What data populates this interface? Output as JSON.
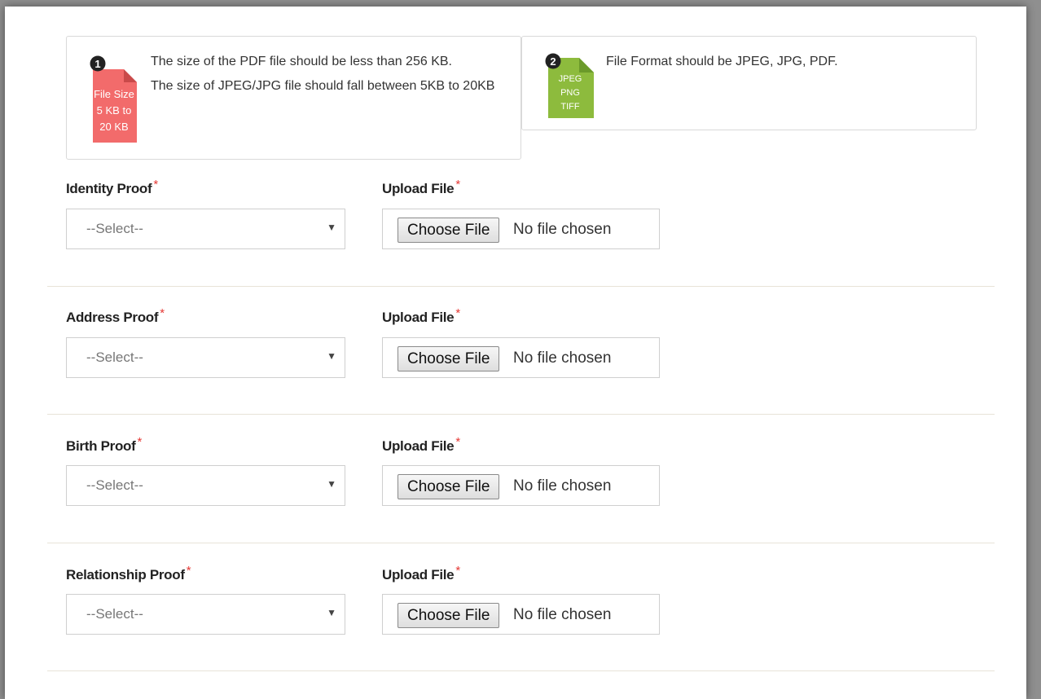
{
  "info_cards": [
    {
      "badge": "1",
      "icon_lines": [
        "File Size",
        "5 KB to",
        "20 KB"
      ],
      "icon_color": "#f26b6b",
      "text": [
        "The size of the PDF file should be less than 256 KB.",
        "The size of JPEG/JPG file should fall between 5KB to 20KB"
      ]
    },
    {
      "badge": "2",
      "icon_lines": [
        "JPEG",
        "PNG",
        "TIFF"
      ],
      "icon_color": "#8dbb3d",
      "text": [
        "File Format should be JPEG, JPG, PDF."
      ]
    }
  ],
  "required_marker": "*",
  "rows": [
    {
      "label": "Identity Proof",
      "select_value": "--Select--",
      "upload_label": "Upload File",
      "button": "Choose File",
      "file_status": "No file chosen"
    },
    {
      "label": "Address Proof",
      "select_value": "--Select--",
      "upload_label": "Upload File",
      "button": "Choose File",
      "file_status": "No file chosen"
    },
    {
      "label": "Birth Proof",
      "select_value": "--Select--",
      "upload_label": "Upload File",
      "button": "Choose File",
      "file_status": "No file chosen"
    },
    {
      "label": "Relationship Proof",
      "select_value": "--Select--",
      "upload_label": "Upload File",
      "button": "Choose File",
      "file_status": "No file chosen"
    }
  ],
  "colors": {
    "required": "#e53935",
    "size_icon": "#f26b6b",
    "format_icon": "#8dbb3d"
  }
}
